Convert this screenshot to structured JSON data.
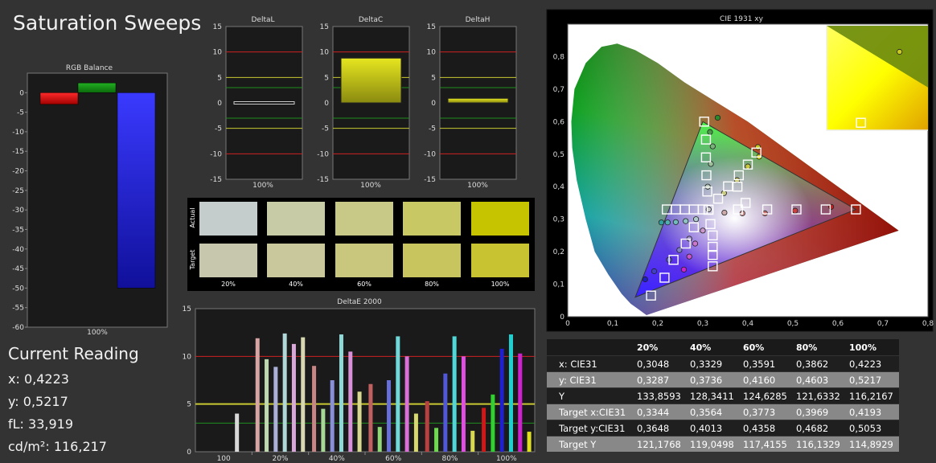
{
  "page": {
    "title": "Saturation Sweeps"
  },
  "current_reading": {
    "heading": "Current Reading",
    "x": "x: 0,4223",
    "y": "y: 0,5217",
    "fl": "fL: 33,919",
    "cd": "cd/m²: 116,217"
  },
  "colors": {
    "background": "#333333",
    "plot_bg": "#1a1a1a",
    "red_line": "#cc2222",
    "yellow_line": "#c8c832",
    "green_line": "#1f8f1f"
  },
  "chart_data": [
    {
      "id": "rgb_balance",
      "type": "bar",
      "title": "RGB Balance",
      "categories": [
        "100%"
      ],
      "series": [
        {
          "name": "R",
          "color": "#e01010",
          "values": [
            -3
          ]
        },
        {
          "name": "G",
          "color": "#1a9a1a",
          "values": [
            2.5
          ]
        },
        {
          "name": "B",
          "color": "#2020f0",
          "values": [
            -50
          ]
        }
      ],
      "ylim": [
        -60,
        5
      ],
      "yticks": [
        0,
        -5,
        -10,
        -15,
        -20,
        -25,
        -30,
        -35,
        -40,
        -45,
        -50,
        -55,
        -60
      ]
    },
    {
      "id": "delta_l",
      "type": "bar",
      "title": "DeltaL",
      "categories": [
        "100%"
      ],
      "values": [
        0.1
      ],
      "ylim": [
        -15,
        15
      ],
      "yticks": [
        15,
        10,
        5,
        0,
        -5,
        -10,
        -15
      ]
    },
    {
      "id": "delta_c",
      "type": "bar",
      "title": "DeltaC",
      "categories": [
        "100%"
      ],
      "values": [
        8.8
      ],
      "ylim": [
        -15,
        15
      ],
      "yticks": [
        15,
        10,
        5,
        0,
        -5,
        -10,
        -15
      ]
    },
    {
      "id": "delta_h",
      "type": "bar",
      "title": "DeltaH",
      "categories": [
        "100%"
      ],
      "values": [
        0.9
      ],
      "ylim": [
        -15,
        15
      ],
      "yticks": [
        15,
        10,
        5,
        0,
        -5,
        -10,
        -15
      ]
    },
    {
      "id": "swatches",
      "type": "table",
      "rows": [
        "Actual",
        "Target"
      ],
      "columns": [
        "20%",
        "40%",
        "60%",
        "80%",
        "100%"
      ],
      "actual": [
        "#c4cccc",
        "#c8cca6",
        "#c8c986",
        "#c8c965",
        "#c6c400"
      ],
      "target": [
        "#c7c7ae",
        "#c9c79c",
        "#c9c67e",
        "#c8c45e",
        "#c8c431"
      ]
    },
    {
      "id": "delta_e",
      "type": "bar",
      "title": "DeltaE 2000",
      "categories": [
        "100",
        "20%",
        "40%",
        "60%",
        "80%",
        "100%"
      ],
      "ylim": [
        0,
        15
      ],
      "yticks": [
        0,
        5,
        10,
        15
      ],
      "groups": [
        {
          "category": "100",
          "bars": [
            {
              "color": "#d8d8d8",
              "value": 4.0
            }
          ]
        },
        {
          "category": "20%",
          "bars": [
            {
              "color": "#d8a5a5",
              "value": 11.9
            },
            {
              "color": "#bfd8b0",
              "value": 9.7
            },
            {
              "color": "#aab0d8",
              "value": 8.9
            },
            {
              "color": "#b0d8d8",
              "value": 12.4
            },
            {
              "color": "#d8a8d8",
              "value": 11.3
            },
            {
              "color": "#d8d8b0",
              "value": 12.0
            }
          ]
        },
        {
          "category": "40%",
          "bars": [
            {
              "color": "#c88585",
              "value": 9.0
            },
            {
              "color": "#a8d898",
              "value": 4.5
            },
            {
              "color": "#8a90d8",
              "value": 7.5
            },
            {
              "color": "#90d8d8",
              "value": 12.3
            },
            {
              "color": "#d890d8",
              "value": 10.5
            },
            {
              "color": "#d8d890",
              "value": 6.3
            }
          ]
        },
        {
          "category": "60%",
          "bars": [
            {
              "color": "#c06060",
              "value": 7.1
            },
            {
              "color": "#90d878",
              "value": 2.6
            },
            {
              "color": "#6670d8",
              "value": 7.5
            },
            {
              "color": "#70d8d8",
              "value": 12.1
            },
            {
              "color": "#d870d8",
              "value": 10.0
            },
            {
              "color": "#d8d870",
              "value": 4.0
            }
          ]
        },
        {
          "category": "80%",
          "bars": [
            {
              "color": "#b84040",
              "value": 5.3
            },
            {
              "color": "#6ed850",
              "value": 2.5
            },
            {
              "color": "#5058d8",
              "value": 8.2
            },
            {
              "color": "#50d8d8",
              "value": 12.1
            },
            {
              "color": "#e050e0",
              "value": 10.0
            },
            {
              "color": "#d8d850",
              "value": 2.2
            }
          ]
        },
        {
          "category": "100%",
          "bars": [
            {
              "color": "#d01818",
              "value": 4.6
            },
            {
              "color": "#30d030",
              "value": 6.0
            },
            {
              "color": "#2020d0",
              "value": 10.8
            },
            {
              "color": "#20d0d0",
              "value": 12.3
            },
            {
              "color": "#d020d0",
              "value": 10.3
            },
            {
              "color": "#e0e020",
              "value": 2.1
            }
          ]
        }
      ]
    },
    {
      "id": "cie",
      "type": "scatter",
      "title": "CIE 1931 xy",
      "xlim": [
        0,
        0.8
      ],
      "ylim": [
        0,
        0.9
      ],
      "xticks": [
        "0",
        "0,1",
        "0,2",
        "0,3",
        "0,4",
        "0,5",
        "0,6",
        "0,7",
        "0,8"
      ],
      "yticks": [
        "0",
        "0,1",
        "0,2",
        "0,3",
        "0,4",
        "0,5",
        "0,6",
        "0,7",
        "0,8"
      ],
      "gamut": [
        [
          0.64,
          0.33
        ],
        [
          0.3,
          0.6
        ],
        [
          0.15,
          0.06
        ]
      ],
      "targets": [
        [
          0.3127,
          0.329
        ],
        [
          0.3127,
          0.329
        ],
        [
          0.22,
          0.33
        ],
        [
          0.24,
          0.33
        ],
        [
          0.26,
          0.33
        ],
        [
          0.28,
          0.33
        ],
        [
          0.3,
          0.33
        ],
        [
          0.378,
          0.33
        ],
        [
          0.443,
          0.33
        ],
        [
          0.508,
          0.33
        ],
        [
          0.573,
          0.33
        ],
        [
          0.64,
          0.33
        ],
        [
          0.303,
          0.6
        ],
        [
          0.307,
          0.545
        ],
        [
          0.307,
          0.49
        ],
        [
          0.308,
          0.435
        ],
        [
          0.31,
          0.385
        ],
        [
          0.395,
          0.35
        ],
        [
          0.377,
          0.4
        ],
        [
          0.334,
          0.363
        ],
        [
          0.356,
          0.401
        ],
        [
          0.38,
          0.435
        ],
        [
          0.4,
          0.468
        ],
        [
          0.419,
          0.505
        ],
        [
          0.28,
          0.275
        ],
        [
          0.262,
          0.225
        ],
        [
          0.235,
          0.175
        ],
        [
          0.215,
          0.12
        ],
        [
          0.185,
          0.065
        ],
        [
          0.317,
          0.285
        ],
        [
          0.322,
          0.25
        ],
        [
          0.322,
          0.215
        ],
        [
          0.322,
          0.19
        ],
        [
          0.322,
          0.155
        ]
      ],
      "actuals": [
        {
          "x": 0.333,
          "y": 0.612,
          "c": "#2a8a2a"
        },
        {
          "x": 0.316,
          "y": 0.568,
          "c": "#4a9a4a"
        },
        {
          "x": 0.322,
          "y": 0.524,
          "c": "#7ab07a"
        },
        {
          "x": 0.318,
          "y": 0.47,
          "c": "#9bbf9b"
        },
        {
          "x": 0.311,
          "y": 0.4,
          "c": "#b8c8b8"
        },
        {
          "x": 0.208,
          "y": 0.29,
          "c": "#30a0a0"
        },
        {
          "x": 0.222,
          "y": 0.29,
          "c": "#50b0b0"
        },
        {
          "x": 0.24,
          "y": 0.291,
          "c": "#70bcbc"
        },
        {
          "x": 0.262,
          "y": 0.294,
          "c": "#90c4c4"
        },
        {
          "x": 0.285,
          "y": 0.3,
          "c": "#b0cccc"
        },
        {
          "x": 0.347,
          "y": 0.38,
          "c": "#cccc80"
        },
        {
          "x": 0.376,
          "y": 0.42,
          "c": "#c6c660"
        },
        {
          "x": 0.4,
          "y": 0.462,
          "c": "#c8c840"
        },
        {
          "x": 0.425,
          "y": 0.492,
          "c": "#d0d020"
        },
        {
          "x": 0.4223,
          "y": 0.5217,
          "c": "#c8c820"
        },
        {
          "x": 0.348,
          "y": 0.32,
          "c": "#ccaaaa"
        },
        {
          "x": 0.388,
          "y": 0.318,
          "c": "#cc9090"
        },
        {
          "x": 0.438,
          "y": 0.318,
          "c": "#cc7070"
        },
        {
          "x": 0.505,
          "y": 0.326,
          "c": "#cc4040"
        },
        {
          "x": 0.585,
          "y": 0.338,
          "c": "#c02020"
        },
        {
          "x": 0.27,
          "y": 0.24,
          "c": "#a090c8"
        },
        {
          "x": 0.248,
          "y": 0.205,
          "c": "#8080c8"
        },
        {
          "x": 0.225,
          "y": 0.175,
          "c": "#6060c8"
        },
        {
          "x": 0.192,
          "y": 0.14,
          "c": "#4040c8"
        },
        {
          "x": 0.172,
          "y": 0.115,
          "c": "#2020c0"
        },
        {
          "x": 0.313,
          "y": 0.33,
          "c": "#c8c8c8"
        },
        {
          "x": 0.3,
          "y": 0.265,
          "c": "#cc99cc"
        },
        {
          "x": 0.283,
          "y": 0.225,
          "c": "#cc77cc"
        },
        {
          "x": 0.27,
          "y": 0.185,
          "c": "#cc55cc"
        },
        {
          "x": 0.258,
          "y": 0.145,
          "c": "#cc22cc"
        }
      ],
      "inset_points": [
        {
          "x": 0.735,
          "y": 0.785,
          "target": false
        },
        {
          "x": 0.69,
          "y": 0.69,
          "target": true
        }
      ]
    },
    {
      "id": "readings_table",
      "type": "table",
      "columns": [
        "",
        "20%",
        "40%",
        "60%",
        "80%",
        "100%"
      ],
      "rows": [
        [
          "x: CIE31",
          "0,3048",
          "0,3329",
          "0,3591",
          "0,3862",
          "0,4223"
        ],
        [
          "y: CIE31",
          "0,3287",
          "0,3736",
          "0,4160",
          "0,4603",
          "0,5217"
        ],
        [
          "Y",
          "133,8593",
          "128,3411",
          "124,6285",
          "121,6332",
          "116,2167"
        ],
        [
          "Target x:CIE31",
          "0,3344",
          "0,3564",
          "0,3773",
          "0,3969",
          "0,4193"
        ],
        [
          "Target y:CIE31",
          "0,3648",
          "0,4013",
          "0,4358",
          "0,4682",
          "0,5053"
        ],
        [
          "Target Y",
          "121,1768",
          "119,0498",
          "117,4155",
          "116,1329",
          "114,8929"
        ]
      ]
    }
  ]
}
